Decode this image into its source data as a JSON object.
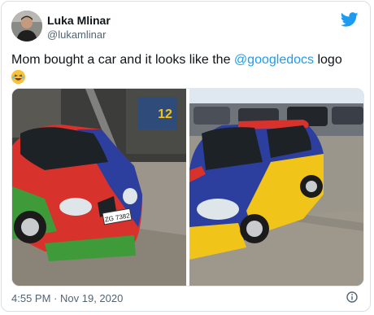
{
  "author": {
    "name": "Luka Mlinar",
    "handle": "@lukamlinar"
  },
  "tweet": {
    "text_before": "Mom bought a car and it looks like the ",
    "mention": "@googledocs",
    "text_after": " logo",
    "emoji": "laughing-face-emoji"
  },
  "photos": {
    "left": {
      "plate_text": "ZG 7382",
      "sign_text": "12"
    },
    "right": {}
  },
  "meta": {
    "time": "4:55 PM",
    "separator": "·",
    "date": "Nov 19, 2020"
  },
  "colors": {
    "mention": "#1d9bf0",
    "twitter_blue": "#1d9bf0",
    "car_red": "#d8322c",
    "car_blue": "#2c3f9e",
    "car_yellow": "#f0c419",
    "car_green": "#3f9b3a"
  }
}
